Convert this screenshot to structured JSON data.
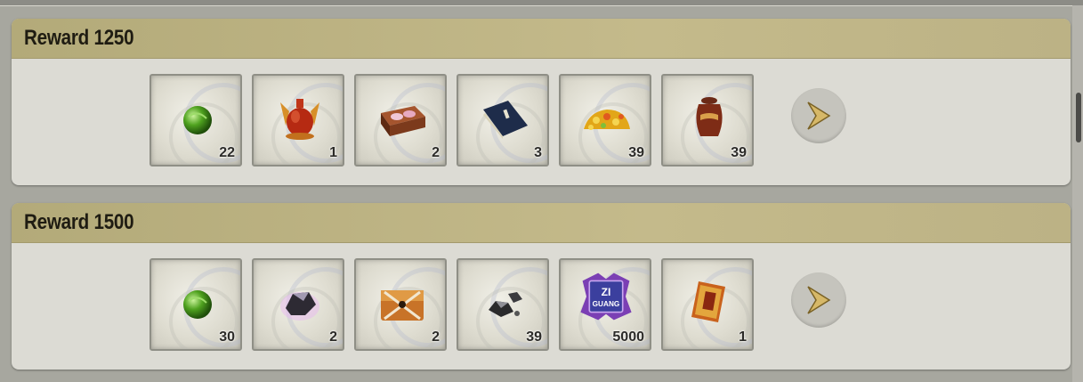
{
  "rewards": [
    {
      "title": "Reward 1250",
      "items": [
        {
          "icon": "green-jade-orb-icon",
          "count": "22"
        },
        {
          "icon": "red-vase-icon",
          "count": "1"
        },
        {
          "icon": "pink-gem-box-icon",
          "count": "2"
        },
        {
          "icon": "blue-book-icon",
          "count": "3"
        },
        {
          "icon": "gold-pile-icon",
          "count": "39"
        },
        {
          "icon": "wine-jar-icon",
          "count": "39"
        }
      ]
    },
    {
      "title": "Reward 1500",
      "items": [
        {
          "icon": "green-jade-orb-icon",
          "count": "30"
        },
        {
          "icon": "purple-ore-icon",
          "count": "2"
        },
        {
          "icon": "treasure-chest-icon",
          "count": "2"
        },
        {
          "icon": "iron-ore-icon",
          "count": "39"
        },
        {
          "icon": "zi-guang-badge-icon",
          "count": "5000",
          "label_line1": "ZI",
          "label_line2": "GUANG"
        },
        {
          "icon": "scroll-token-icon",
          "count": "1"
        }
      ]
    }
  ],
  "colors": {
    "header": "#bfb584",
    "panel": "#dcdbd4",
    "arrow": "#d6b868"
  }
}
